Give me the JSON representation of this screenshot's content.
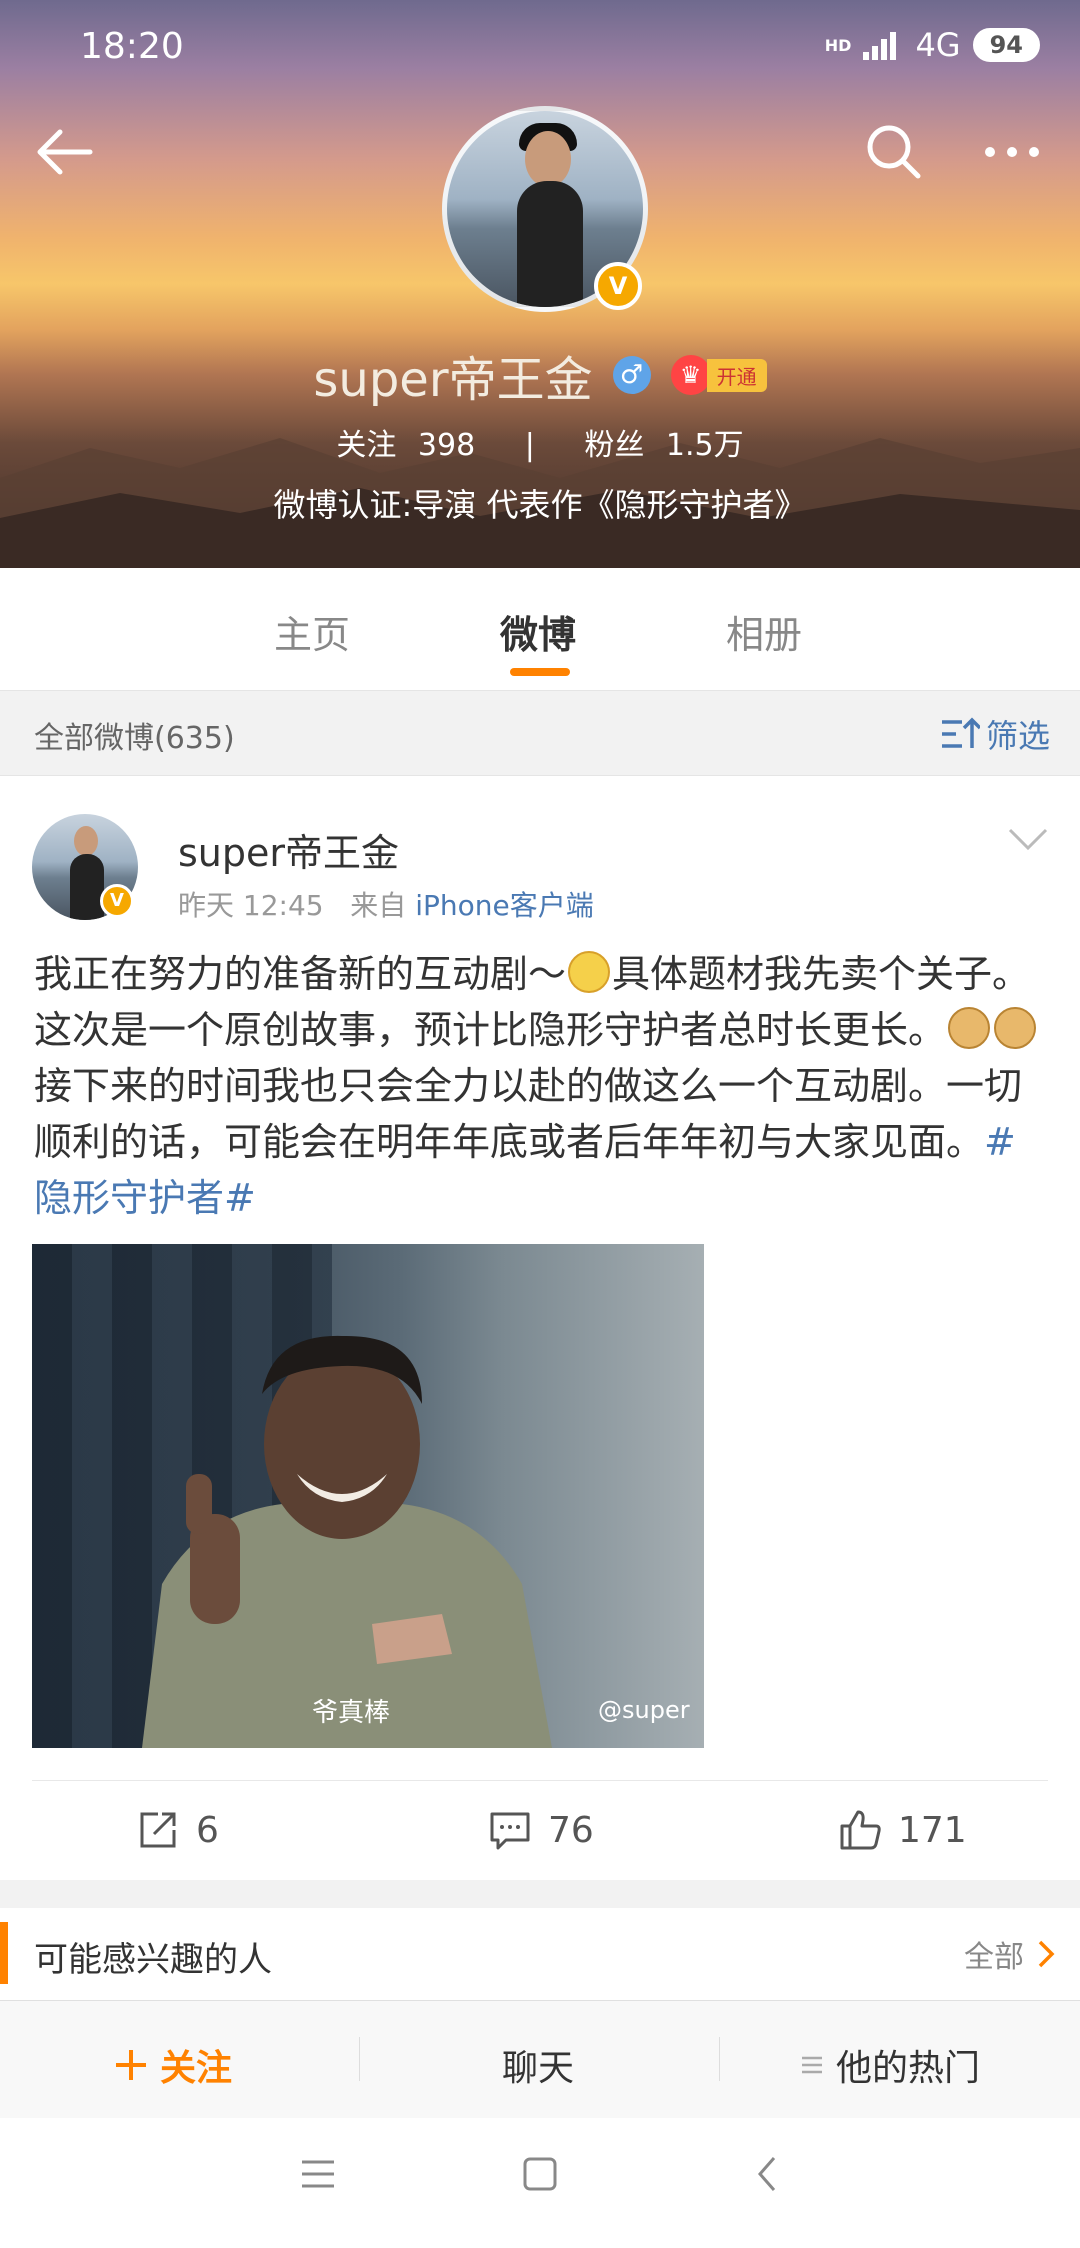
{
  "status_bar": {
    "time": "18:20",
    "network": "4G",
    "hd": "HD",
    "battery": "94"
  },
  "profile": {
    "name": "super帝王金",
    "vip_label": "开通",
    "following_label": "关注",
    "following_count": "398",
    "separator": "|",
    "followers_label": "粉丝",
    "followers_count": "1.5万",
    "verification": "微博认证:导演 代表作《隐形守护者》",
    "badge": "V"
  },
  "tabs": [
    {
      "label": "主页",
      "active": false
    },
    {
      "label": "微博",
      "active": true
    },
    {
      "label": "相册",
      "active": false
    }
  ],
  "filter": {
    "title": "全部微博(635)",
    "button": "筛选"
  },
  "post": {
    "author": "super帝王金",
    "time": "昨天 12:45",
    "from_label": "来自",
    "source": "iPhone客户端",
    "text_1": "我正在努力的准备新的互动剧～",
    "text_2": "具体题材我先卖个关子。这次是一个原创故事，预计比隐形守护者总时长更长。",
    "text_3": "接下来的时间我也只会全力以赴的做这么一个互动剧。一切顺利的话，可能会在明年年底或者后年年初与大家见面。",
    "hashtag": "#隐形守护者#",
    "image_caption": "爷真棒",
    "watermark": "@super",
    "reposts": "6",
    "comments": "76",
    "likes": "171"
  },
  "interest": {
    "title": "可能感兴趣的人",
    "all": "全部"
  },
  "bottom_bar": {
    "follow": "关注",
    "chat": "聊天",
    "hot": "他的热门"
  },
  "colors": {
    "accent": "#ff8200",
    "link": "#4a79b3",
    "badge": "#f6a800"
  }
}
